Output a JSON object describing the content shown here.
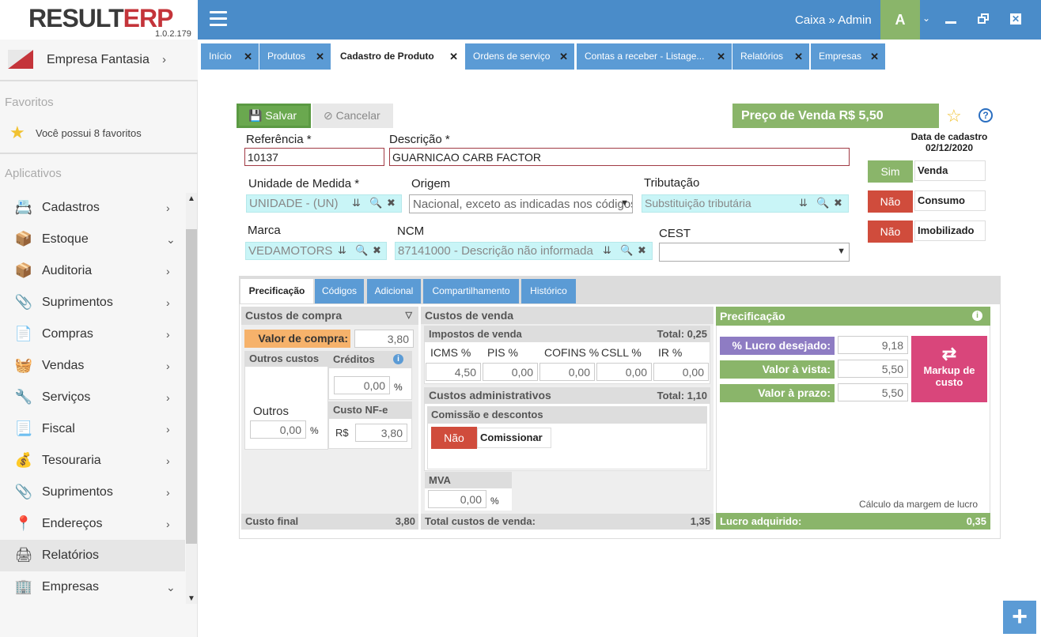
{
  "app": {
    "logo_main": "RESULT",
    "logo_accent": "ERP",
    "version": "1.0.2.179",
    "user": "Caixa » Admin",
    "avatar_letter": "A",
    "caret": "˅"
  },
  "sidebar": {
    "company": "Empresa Fantasia",
    "favorites_title": "Favoritos",
    "favorites_text": "Você possui 8 favoritos",
    "apps_title": "Aplicativos",
    "items": [
      {
        "label": "Cadastros",
        "icon": "id-card-icon",
        "chev": "›"
      },
      {
        "label": "Estoque",
        "icon": "boxes-icon",
        "chev": "⌄"
      },
      {
        "label": "Auditoria",
        "icon": "boxes-icon",
        "chev": "›"
      },
      {
        "label": "Suprimentos",
        "icon": "paperclip-icon",
        "chev": "›"
      },
      {
        "label": "Compras",
        "icon": "receipt-icon",
        "chev": "›"
      },
      {
        "label": "Vendas",
        "icon": "basket-icon",
        "chev": "›"
      },
      {
        "label": "Serviços",
        "icon": "wrench-icon",
        "chev": "›"
      },
      {
        "label": "Fiscal",
        "icon": "document-icon",
        "chev": "›"
      },
      {
        "label": "Tesouraria",
        "icon": "coins-icon",
        "chev": "›"
      },
      {
        "label": "Suprimentos",
        "icon": "paperclip-icon",
        "chev": "›"
      },
      {
        "label": "Endereços",
        "icon": "map-pin-icon",
        "chev": "›"
      },
      {
        "label": "Relatórios",
        "icon": "printer-icon",
        "chev": ""
      },
      {
        "label": "Empresas",
        "icon": "building-icon",
        "chev": "⌄"
      }
    ]
  },
  "tabs": [
    {
      "label": "Início"
    },
    {
      "label": "Produtos"
    },
    {
      "label": "Cadastro de Produto"
    },
    {
      "label": "Ordens de serviço"
    },
    {
      "label": "Contas a receber - Listage..."
    },
    {
      "label": "Relatórios"
    },
    {
      "label": "Empresas"
    }
  ],
  "toolbar": {
    "save": "Salvar",
    "cancel": "Cancelar",
    "price": "Preço de Venda R$  5,50"
  },
  "form": {
    "referencia_label": "Referência *",
    "referencia": "10137",
    "descricao_label": "Descrição *",
    "descricao": "GUARNICAO CARB FACTOR",
    "unidade_label": "Unidade de Medida *",
    "unidade": "UNIDADE - (UN)",
    "origem_label": "Origem",
    "origem": "Nacional, exceto as indicadas nos códigos",
    "tributacao_label": "Tributação",
    "tributacao": "Substituição tributária",
    "marca_label": "Marca",
    "marca": "VEDAMOTORS",
    "ncm_label": "NCM",
    "ncm": "87141000 - Descrição não informada",
    "cest_label": "CEST",
    "cest": "",
    "data_cadastro_label": "Data de cadastro",
    "data_cadastro": "02/12/2020"
  },
  "flags": [
    {
      "state": "Sim",
      "label": "Venda"
    },
    {
      "state": "Não",
      "label": "Consumo"
    },
    {
      "state": "Não",
      "label": "Imobilizado"
    }
  ],
  "ptabs": [
    "Precificação",
    "Códigos",
    "Adicional",
    "Compartilhamento",
    "Histórico"
  ],
  "compra": {
    "title": "Custos de compra",
    "valor_label": "Valor de compra:",
    "valor": "3,80",
    "outros_custos": "Outros custos",
    "creditos": "Créditos",
    "creditos_val": "0,00",
    "pct": "%",
    "outros_label": "Outros",
    "outros_val": "0,00",
    "custo_nfe": "Custo NF-e",
    "rs": "R$",
    "nfe_val": "3,80",
    "custo_final_label": "Custo final",
    "custo_final": "3,80"
  },
  "venda": {
    "title": "Custos de venda",
    "impostos_title": "Impostos de venda",
    "impostos_total": "Total: 0,25",
    "tax_headers": [
      "ICMS %",
      "PIS %",
      "COFINS %",
      "CSLL %",
      "IR %"
    ],
    "tax_values": [
      "4,50",
      "0,00",
      "0,00",
      "0,00",
      "0,00"
    ],
    "adm_title": "Custos administrativos",
    "adm_total": "Total: 1,10",
    "comissao_title": "Comissão e descontos",
    "comissao_state": "Não",
    "comissao_label": "Comissionar",
    "mva_label": "MVA",
    "mva_val": "0,00",
    "pct": "%",
    "total_label": "Total custos de venda:",
    "total": "1,35"
  },
  "preco": {
    "title": "Precificação",
    "lucro_label": "% Lucro desejado:",
    "lucro": "9,18",
    "avista_label": "Valor à vista:",
    "avista": "5,50",
    "aprazo_label": "Valor à prazo:",
    "aprazo": "5,50",
    "markup": "Markup de custo",
    "calc_label": "Cálculo da margem de lucro",
    "lucro_adq_label": "Lucro adquirido:",
    "lucro_adq": "0,35"
  },
  "colors": {
    "topbar": "#4a8cc9",
    "green": "#8ab56a",
    "red": "#d04c3c",
    "tab": "#5b9bd5",
    "pink": "#d9467b",
    "purple": "#8e7cc3",
    "orange": "#f6b26b"
  }
}
